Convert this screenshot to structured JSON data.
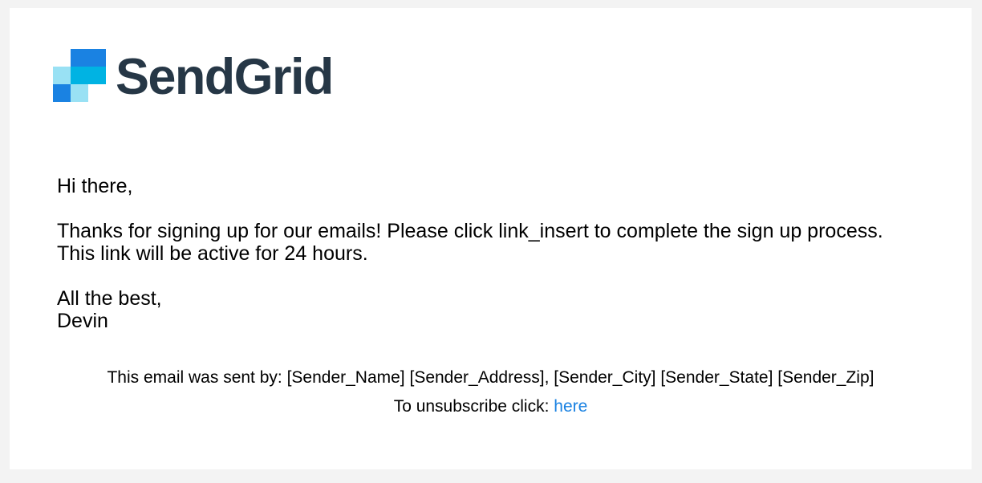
{
  "brand": {
    "name": "SendGrid",
    "logo_icon": "sendgrid-logo-mark",
    "colors": {
      "wordmark": "#263746",
      "logo_dark_blue": "#1a82e2",
      "logo_mid_blue": "#00b3e3",
      "logo_light_blue": "#99e1f4",
      "link": "#1a82e2",
      "page_background": "#f3f3f3",
      "card_background": "#ffffff"
    }
  },
  "email": {
    "greeting": "Hi there,",
    "message": "Thanks for signing up for our emails! Please click link_insert to complete the sign up process.  This link will be active for 24 hours.",
    "closing": "All the best,",
    "signature": "Devin"
  },
  "footer": {
    "sender_line": "This email was sent by: [Sender_Name] [Sender_Address], [Sender_City] [Sender_State] [Sender_Zip]",
    "unsubscribe_prefix": "To unsubscribe click: ",
    "unsubscribe_link_label": "here"
  }
}
